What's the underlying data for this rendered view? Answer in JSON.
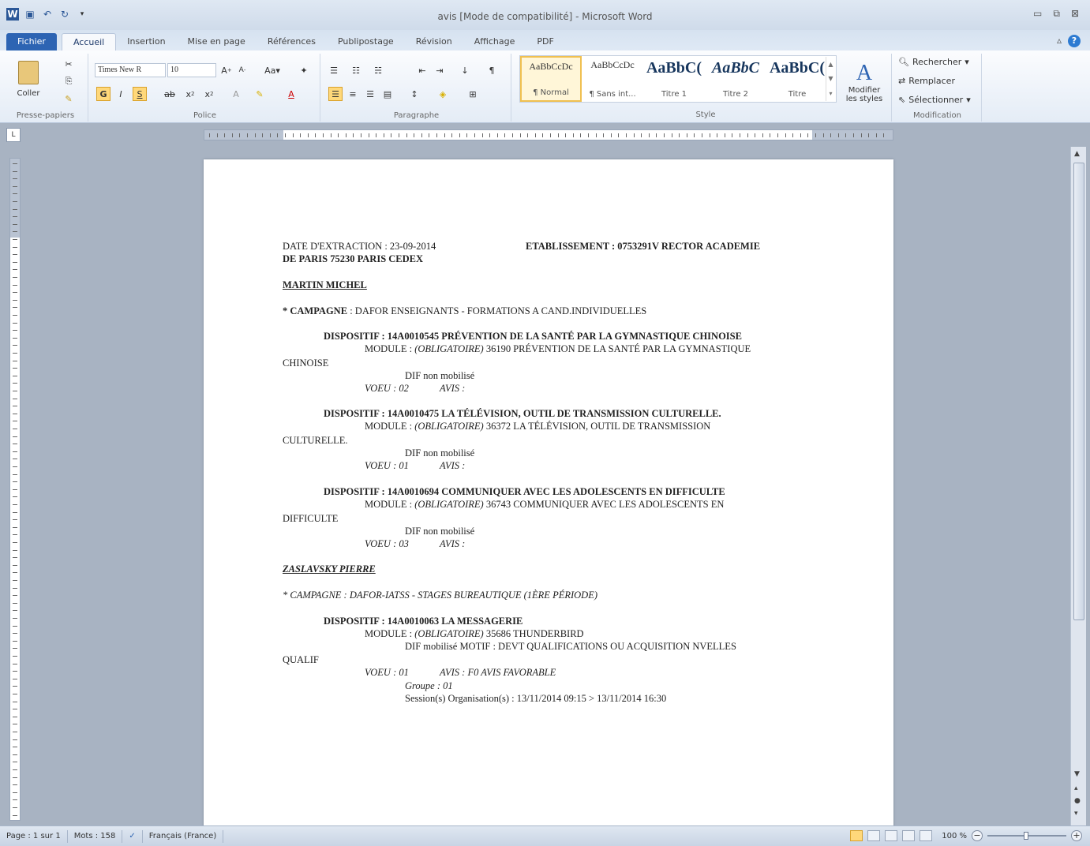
{
  "window": {
    "title": "avis [Mode de compatibilité] - Microsoft Word"
  },
  "tabs": [
    "Fichier",
    "Accueil",
    "Insertion",
    "Mise en page",
    "Références",
    "Publipostage",
    "Révision",
    "Affichage",
    "PDF"
  ],
  "ribbon": {
    "clipboard": {
      "paste_label": "Coller",
      "group_label": "Presse-papiers"
    },
    "font": {
      "font_name": "Times New R",
      "font_size": "10",
      "group_label": "Police"
    },
    "paragraph": {
      "group_label": "Paragraphe"
    },
    "styles": {
      "group_label": "Style",
      "items": [
        {
          "preview": "AaBbCcDc",
          "name": "¶ Normal"
        },
        {
          "preview": "AaBbCcDc",
          "name": "¶ Sans int..."
        },
        {
          "preview": "AaBbC(",
          "name": "Titre 1"
        },
        {
          "preview": "AaBbC",
          "name": "Titre 2"
        },
        {
          "preview": "AaBbC(",
          "name": "Titre"
        }
      ],
      "modify_label_1": "Modifier",
      "modify_label_2": "les styles"
    },
    "editing": {
      "find": "Rechercher",
      "replace": "Remplacer",
      "select": "Sélectionner",
      "group_label": "Modification"
    }
  },
  "document": {
    "line1_left": "DATE D'EXTRACTION : 23-09-2014",
    "line1_right": "ETABLISSEMENT : 0753291V RECTOR ACADEMIE",
    "line2": "DE PARIS 75230 PARIS CEDEX",
    "person1": "MARTIN MICHEL",
    "campaign1_label": "* CAMPAGNE",
    "campaign1_text": ": DAFOR ENSEIGNANTS - FORMATIONS A CAND.INDIVIDUELLES",
    "d1_title": "DISPOSITIF : 14A0010545  PRÉVENTION DE LA SANTÉ PAR LA GYMNASTIQUE  CHINOISE",
    "d1_module_label": "MODULE :",
    "d1_module_oblig": "(OBLIGATOIRE)",
    "d1_module_text": "36190 PRÉVENTION DE LA SANTÉ PAR LA GYMNASTIQUE",
    "d1_module_cont": "CHINOISE",
    "d1_dif": "DIF non mobilisé",
    "d1_voeu": "VOEU : 02",
    "d1_avis": "AVIS :",
    "d2_title": "DISPOSITIF : 14A0010475  LA TÉLÉVISION, OUTIL DE TRANSMISSION  CULTURELLE.",
    "d2_module_label": "MODULE :",
    "d2_module_oblig": "(OBLIGATOIRE)",
    "d2_module_text": "36372 LA TÉLÉVISION, OUTIL DE TRANSMISSION",
    "d2_module_cont": "CULTURELLE.",
    "d2_dif": "DIF non mobilisé",
    "d2_voeu": "VOEU : 01",
    "d2_avis": "AVIS :",
    "d3_title": "DISPOSITIF : 14A0010694  COMMUNIQUER  AVEC LES ADOLESCENTS  EN DIFFICULTE",
    "d3_module_label": "MODULE :",
    "d3_module_oblig": "(OBLIGATOIRE)",
    "d3_module_text": "36743 COMMUNIQUER AVEC LES ADOLESCENTS EN",
    "d3_module_cont": "DIFFICULTE",
    "d3_dif": "DIF non mobilisé",
    "d3_voeu": "VOEU : 03",
    "d3_avis": "AVIS :",
    "person2": "ZASLAVSKY PIERRE",
    "campaign2": "* CAMPAGNE : DAFOR-IATSS - STAGES BUREAUTIQUE (1ÈRE PÉRIODE)",
    "d4_title": "DISPOSITIF : 14A0010063  LA MESSAGERIE",
    "d4_module_label": "MODULE :",
    "d4_module_oblig": "(OBLIGATOIRE)",
    "d4_module_text": "35686 THUNDERBIRD",
    "d4_dif": "DIF mobilisé MOTIF : DEVT QUALIFICATIONS OU ACQUISITION NVELLES",
    "d4_dif_cont": "QUALIF",
    "d4_voeu": "VOEU : 01",
    "d4_avis": "AVIS : F0 AVIS FAVORABLE",
    "d4_groupe": "Groupe : 01",
    "d4_session": "Session(s) Organisation(s) : 13/11/2014 09:15 > 13/11/2014 16:30"
  },
  "statusbar": {
    "page": "Page : 1 sur 1",
    "words": "Mots : 158",
    "language": "Français (France)",
    "zoom": "100 %"
  }
}
